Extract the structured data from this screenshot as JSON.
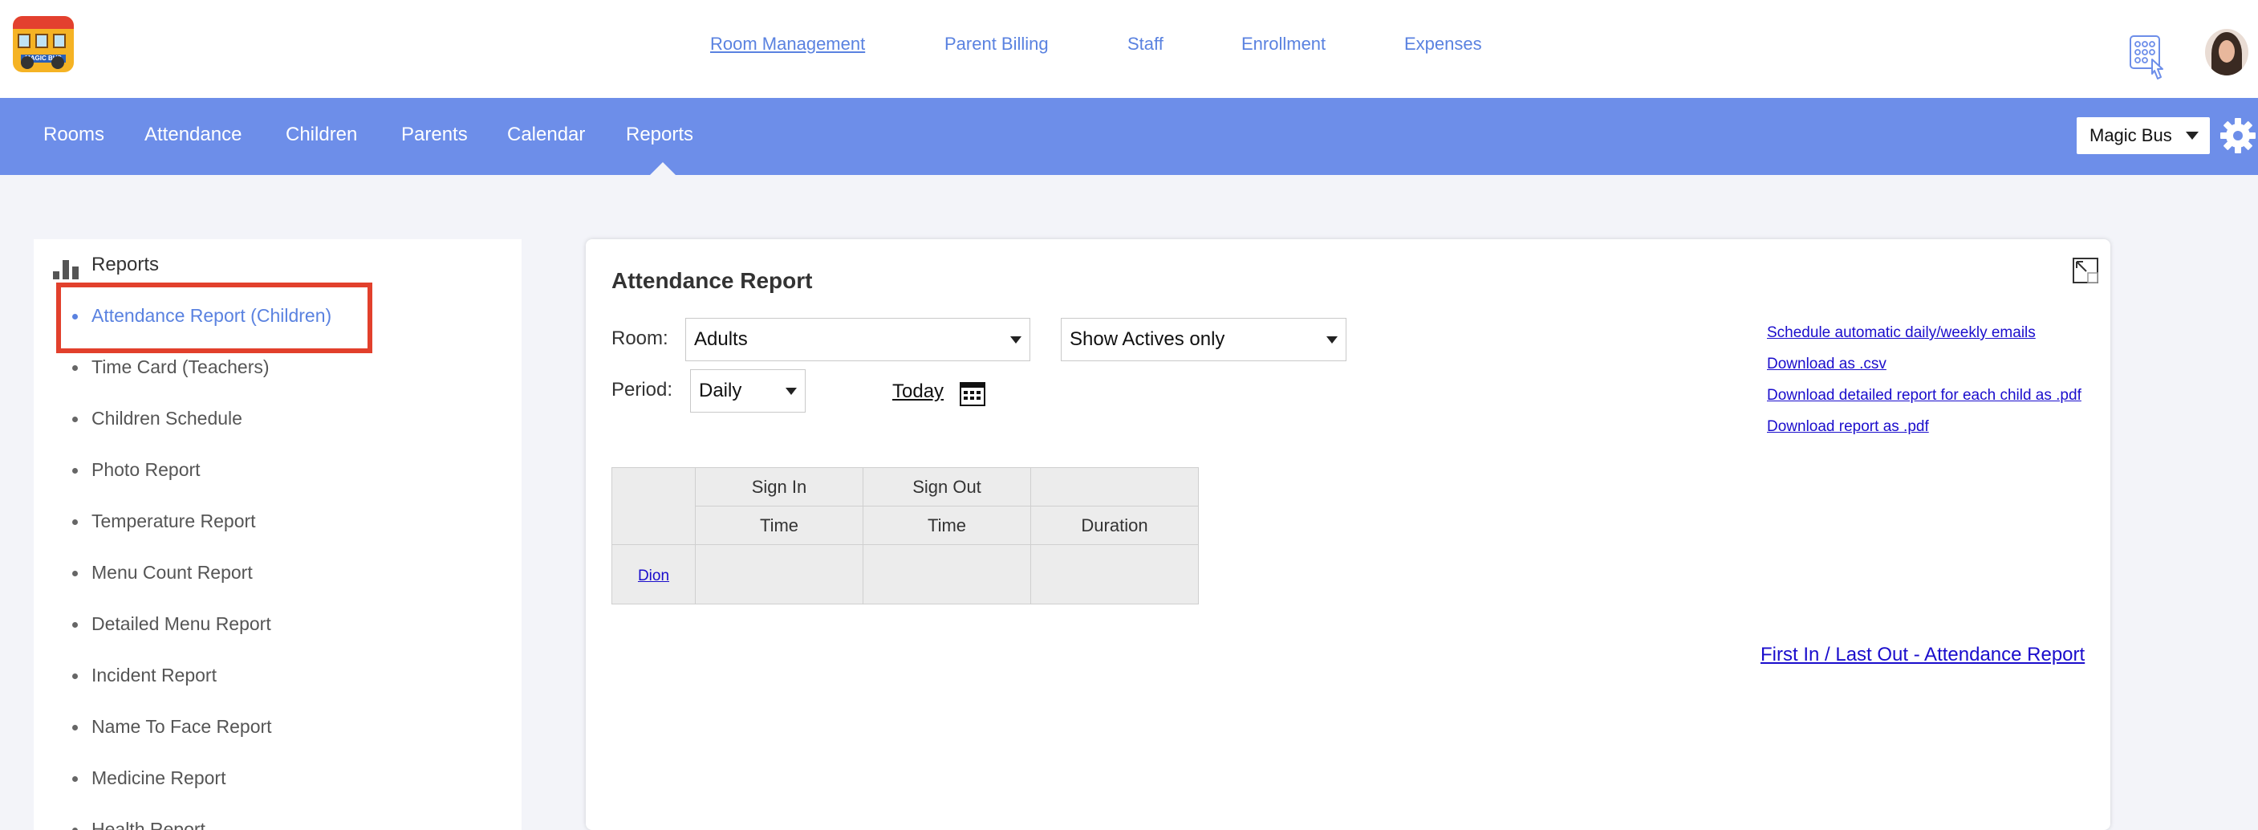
{
  "logo": {
    "text": "MAGIC BUS"
  },
  "top_nav": {
    "items": [
      {
        "label": "Room Management",
        "active": true
      },
      {
        "label": "Parent Billing"
      },
      {
        "label": "Staff"
      },
      {
        "label": "Enrollment"
      },
      {
        "label": "Expenses"
      }
    ]
  },
  "sub_nav": {
    "items": [
      {
        "label": "Rooms"
      },
      {
        "label": "Attendance"
      },
      {
        "label": "Children"
      },
      {
        "label": "Parents"
      },
      {
        "label": "Calendar"
      },
      {
        "label": "Reports",
        "active": true
      }
    ],
    "school_select": "Magic Bus"
  },
  "sidebar": {
    "title": "Reports",
    "items": [
      {
        "label": "Attendance Report (Children)",
        "active": true
      },
      {
        "label": "Time Card (Teachers)"
      },
      {
        "label": "Children Schedule"
      },
      {
        "label": "Photo Report"
      },
      {
        "label": "Temperature Report"
      },
      {
        "label": "Menu Count Report"
      },
      {
        "label": "Detailed Menu Report"
      },
      {
        "label": "Incident Report"
      },
      {
        "label": "Name To Face Report"
      },
      {
        "label": "Medicine Report"
      },
      {
        "label": "Health Report"
      }
    ]
  },
  "report": {
    "title": "Attendance Report",
    "room_label": "Room:",
    "room_value": "Adults",
    "filter_value": "Show Actives only",
    "period_label": "Period:",
    "period_value": "Daily",
    "today_label": "Today",
    "links": [
      "Schedule automatic daily/weekly emails",
      "Download as .csv",
      "Download detailed report for each child as .pdf",
      "Download report as .pdf"
    ],
    "table": {
      "header_row1": [
        "",
        "Sign In",
        "Sign Out",
        ""
      ],
      "header_row2": [
        "",
        "Time",
        "Time",
        "Duration"
      ],
      "rows": [
        {
          "name": "Dion",
          "sign_in": "",
          "sign_out": "",
          "duration": ""
        }
      ]
    },
    "first_last_link": "First In / Last Out - Attendance Report"
  },
  "colors": {
    "primary_blue": "#6d8ee9",
    "link_blue": "#5a82e0",
    "highlight_red": "#e2402c"
  }
}
